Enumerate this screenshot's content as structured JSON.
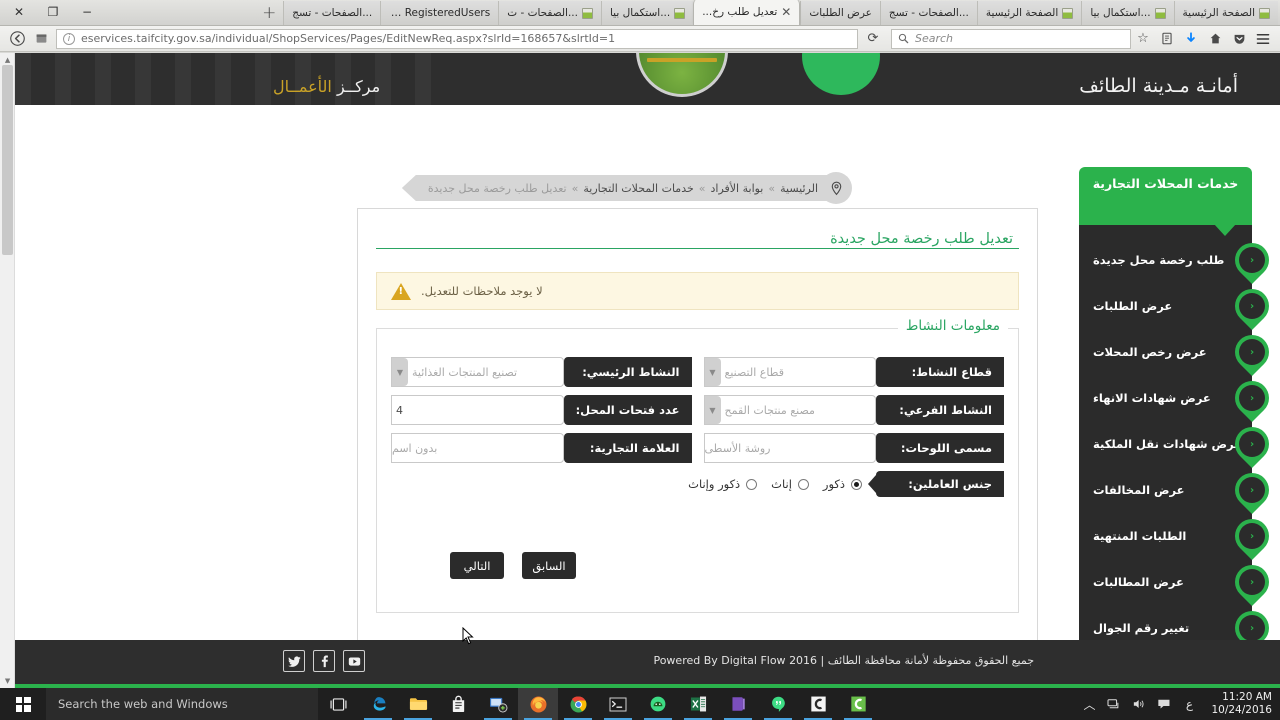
{
  "browser": {
    "tabs": [
      {
        "title": "الصفحة الرئيسية",
        "active": false,
        "favicon": true
      },
      {
        "title": "...استكمال بيا",
        "active": false,
        "favicon": true
      },
      {
        "title": "الصفحة الرئيسية",
        "active": false,
        "favicon": true
      },
      {
        "title": "...الصفحات - تسج",
        "active": false,
        "favicon": false
      },
      {
        "title": "عرض الطلبات",
        "active": false,
        "favicon": false
      },
      {
        "title": "تعديل طلب رخ...",
        "active": true,
        "favicon": false
      },
      {
        "title": "...استكمال بيا",
        "active": false,
        "favicon": true
      },
      {
        "title": "...الصفحات - ت",
        "active": false,
        "favicon": true
      },
      {
        "title": "RegisteredUsers - كا...",
        "active": false,
        "favicon": false
      },
      {
        "title": "...الصفحات - تسج",
        "active": false,
        "favicon": false
      }
    ],
    "new_tab_label": "+",
    "close_tab_label": "✕",
    "window_controls": {
      "minimize": "−",
      "maximize": "❐",
      "close": "✕"
    },
    "back_icon": "←",
    "url": "eservices.taifcity.gov.sa/individual/ShopServices/Pages/EditNewReq.aspx?slrId=168657&slrtId=1",
    "url_domain": "eservices.taifcity.gov.sa",
    "url_path": "/individual/ShopServices/Pages/EditNewReq.aspx?slrId=168657&slrtId=1",
    "reload_icon": "⟳",
    "search_placeholder": "Search",
    "toolbar_icons": [
      "bookmark-star",
      "library",
      "downloads",
      "home",
      "pocket",
      "menu"
    ]
  },
  "site": {
    "header": {
      "title_right": "أمانـة مـدينة الطائف",
      "title_left_plain": "مركــز ",
      "title_left_gold": "الأعمــال"
    },
    "breadcrumb": {
      "items": [
        "الرئيسية",
        "بوابة الأفراد",
        "خدمات المحلات التجارية",
        "تعديل طلب رخصة محل جديدة"
      ],
      "separator": "»",
      "pin_icon": "location-pin"
    },
    "sidebar": {
      "heading": "خدمات المحلات التجارية",
      "items": [
        {
          "label": "طلب رخصة محل جديدة"
        },
        {
          "label": "عرض الطلبات"
        },
        {
          "label": "عرض رخص المحلات"
        },
        {
          "label": "عرض شهادات الانهاء"
        },
        {
          "label": "عرض شهادات نقل الملكية"
        },
        {
          "label": "عرض المخالفات"
        },
        {
          "label": "الطلبات المنتهية"
        },
        {
          "label": "عرض المطالبات"
        },
        {
          "label": "تغيير رقم الجوال"
        }
      ],
      "chevron": "‹"
    },
    "card": {
      "title": "تعديل طلب رخصة محل جديدة",
      "alert_text": "لا يوجد ملاحظات للتعديل.",
      "alert_icon": "warning-triangle",
      "fieldset_legend": "معلومات النشاط",
      "fields": {
        "activity_sector": {
          "label": "قطاع النشاط:",
          "value": "قطاع التصنيع",
          "type": "select"
        },
        "main_activity": {
          "label": "النشاط الرئيسي:",
          "value": "تصنيع المنتجات الغذائية",
          "type": "select"
        },
        "sub_activity": {
          "label": "النشاط الفرعي:",
          "value": "مصنع منتجات القمح",
          "type": "select"
        },
        "shop_openings": {
          "label": "عدد فتحات المحل:",
          "value": "4",
          "type": "text"
        },
        "sign_name": {
          "label": "مسمى اللوحات:",
          "value": "روشة الأسطى",
          "type": "text"
        },
        "trade_mark": {
          "label": "العلامة التجارية:",
          "value": "بدون اسم",
          "type": "text"
        }
      },
      "gender": {
        "label": "جنس العاملين:",
        "options": [
          {
            "label": "ذكور",
            "selected": true
          },
          {
            "label": "إناث",
            "selected": false
          },
          {
            "label": "ذكور وإناث",
            "selected": false
          }
        ]
      },
      "buttons": {
        "prev": "السابق",
        "next": "التالي"
      }
    },
    "footer": {
      "copyright": "جميع الحقوق محفوظة لأمانة محافظة الطائف | 2016 Powered By Digital Flow",
      "socials": [
        "youtube-icon",
        "facebook-icon",
        "twitter-icon"
      ]
    },
    "colors": {
      "brand_green": "#2bb24c",
      "title_green": "#2aa562",
      "dark": "#2b2b2b",
      "alert_bg": "#fdf7e2",
      "alert_border": "#efe4c0"
    }
  },
  "taskbar": {
    "search_placeholder": "Search the web and Windows",
    "start_icon": "windows-logo",
    "task_view_icon": "task-view-icon",
    "apps": [
      "edge-icon",
      "file-explorer-icon",
      "store-icon",
      "remote-desktop-icon",
      "firefox-icon",
      "chrome-icon",
      "cmd-icon",
      "android-studio-icon",
      "excel-icon",
      "onenote-icon",
      "hangouts-icon",
      "c-app-icon-1",
      "c-app-icon-2"
    ],
    "tray": [
      "show-hidden-icon",
      "network-icon",
      "volume-icon",
      "action-center-icon",
      "arabic-input-icon"
    ],
    "time": "11:20 AM",
    "date": "10/24/2016"
  }
}
